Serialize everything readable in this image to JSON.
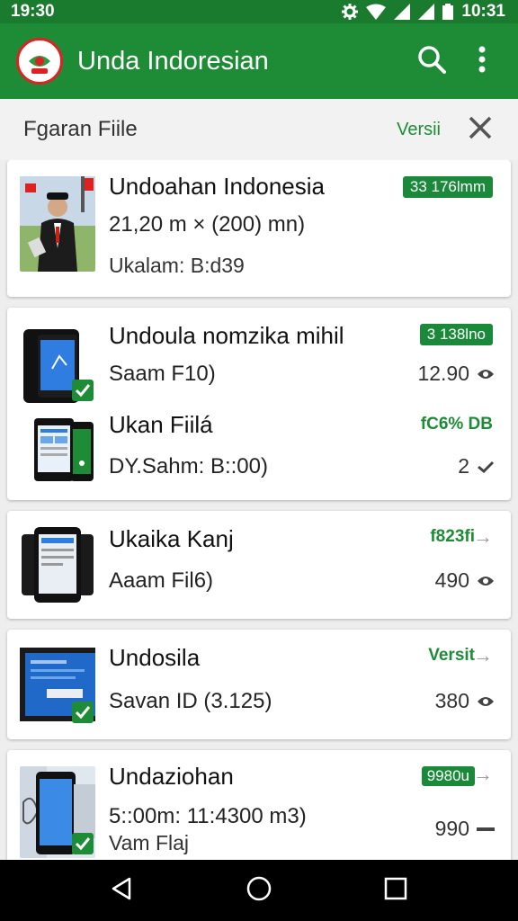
{
  "status_bar": {
    "time": "19:30",
    "clock": "10:31"
  },
  "app_bar": {
    "title": "Unda Indoresian"
  },
  "subheader": {
    "title": "Fgaran Fiile",
    "action": "Versii"
  },
  "items": [
    {
      "name": "Undoahan Indonesia",
      "line2": "21,20 m × (200) mn)",
      "line3": "Ukalam: B:d39",
      "badge": "33 176lmm"
    },
    {
      "name": "Undoula nomzika mihil",
      "line2": "Saam F10)",
      "badge": "3 138lno",
      "meta": "12.90"
    },
    {
      "name": "Ukan Fiilá",
      "line2": "DY.Sahm: B::00)",
      "gtext": "fC6% DB",
      "meta": "2"
    },
    {
      "name": "Ukaika Kanj",
      "line2": "Aaam Fil6)",
      "gtext": "f823fi",
      "arrow": "→",
      "meta": "490"
    },
    {
      "name": "Undosila",
      "line2": "Savan ID (3.125)",
      "gtext": "Versit",
      "arrow": "→",
      "meta": "380"
    },
    {
      "name": "Undaziohan",
      "line2": "5::00m: 11:4300 m3)",
      "line3": "Vam Flaj",
      "badge": "9980u",
      "arrow": "→",
      "meta": "990"
    }
  ],
  "colors": {
    "primary": "#1e8c36",
    "status_bar": "#1a7a2e",
    "badge": "#1a8a3a"
  },
  "icons": [
    "settings-icon",
    "wifi-icon",
    "signal-icon",
    "battery-icon",
    "search-icon",
    "more-vert-icon",
    "close-icon",
    "view-icon",
    "check-icon",
    "back-icon",
    "home-icon",
    "recents-icon"
  ]
}
